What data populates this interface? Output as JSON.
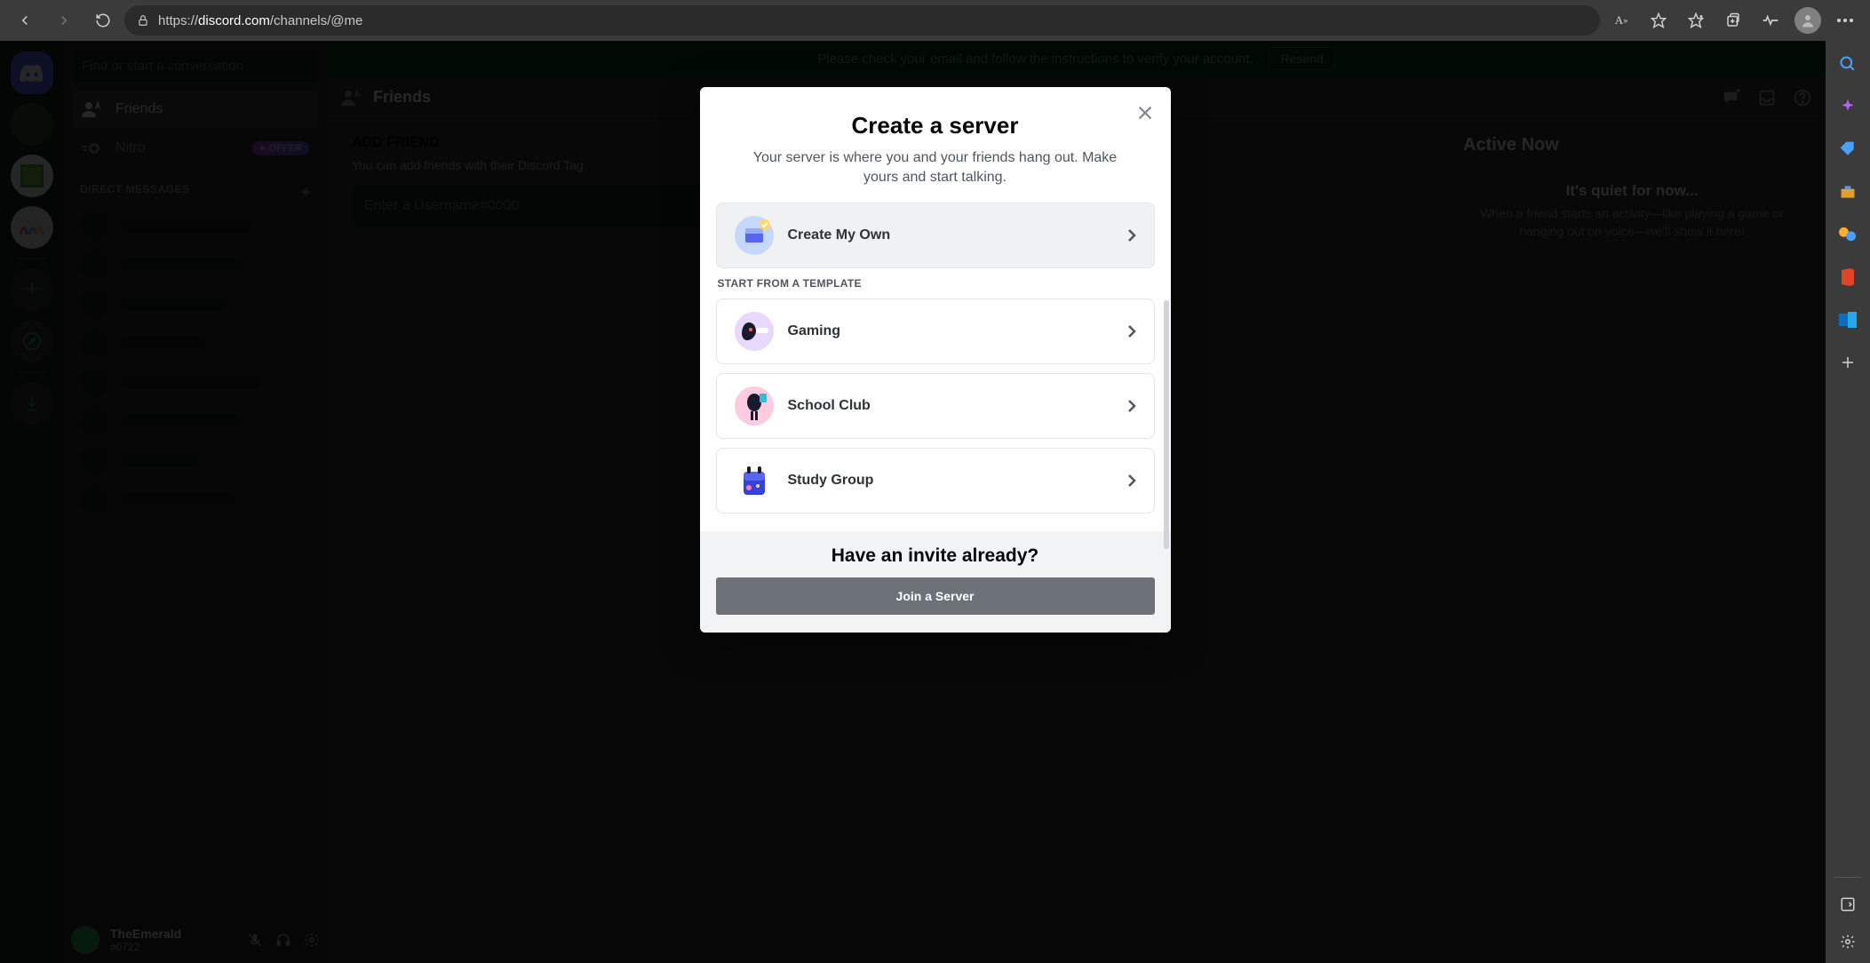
{
  "browser": {
    "url_scheme": "https://",
    "url_domain": "discord.com",
    "url_path": "/channels/@me"
  },
  "banner": {
    "text": "Please check your email and follow the instructions to verify your account.",
    "resend": "Resend"
  },
  "sidebar": {
    "find_placeholder": "Find or start a conversation",
    "friends": "Friends",
    "nitro": "Nitro",
    "offer": "OFFER",
    "dm_header": "DIRECT MESSAGES"
  },
  "user": {
    "name": "TheEmerald",
    "tag": "#0722"
  },
  "header": {
    "title": "Friends"
  },
  "add": {
    "title": "ADD FRIEND",
    "sub": "You can add friends with their Discord Tag.",
    "placeholder": "Enter a Username#0000"
  },
  "active": {
    "title": "Active Now",
    "quiet": "It's quiet for now...",
    "quiet_sub": "When a friend starts an activity—like playing a game or hanging out on voice—we'll show it here!"
  },
  "modal": {
    "title": "Create a server",
    "sub": "Your server is where you and your friends hang out. Make yours and start talking.",
    "create_own": "Create My Own",
    "template_header": "START FROM A TEMPLATE",
    "templates": [
      "Gaming",
      "School Club",
      "Study Group"
    ],
    "invite_title": "Have an invite already?",
    "join": "Join a Server"
  }
}
